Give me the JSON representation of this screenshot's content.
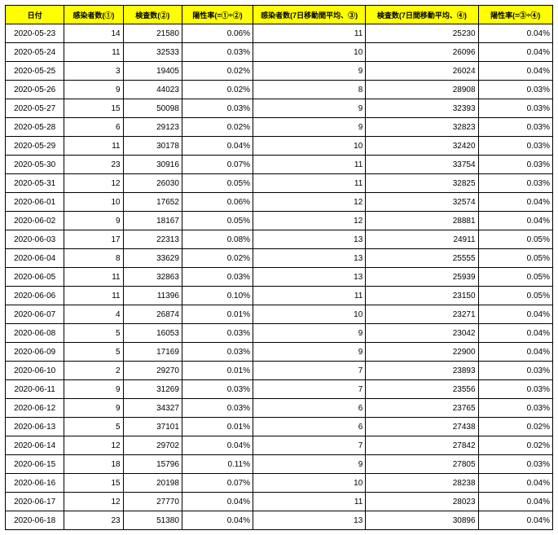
{
  "headers": {
    "date": "日付",
    "infected": "感染者数(①)",
    "tested": "検査数(②)",
    "positivity": "陽性率(=①÷②)",
    "infected7": "感染者数(7日移動間平均、③)",
    "tested7": "検査数(7日間移動平均、④)",
    "positivity7": "陽性率(=③÷④)"
  },
  "rows": [
    {
      "date": "2020-05-23",
      "inf": "14",
      "test": "21580",
      "pos": "0.06%",
      "inf7": "11",
      "test7": "25230",
      "pos7": "0.04%"
    },
    {
      "date": "2020-05-24",
      "inf": "11",
      "test": "32533",
      "pos": "0.03%",
      "inf7": "10",
      "test7": "26096",
      "pos7": "0.04%"
    },
    {
      "date": "2020-05-25",
      "inf": "3",
      "test": "19405",
      "pos": "0.02%",
      "inf7": "9",
      "test7": "26024",
      "pos7": "0.04%"
    },
    {
      "date": "2020-05-26",
      "inf": "9",
      "test": "44023",
      "pos": "0.02%",
      "inf7": "8",
      "test7": "28908",
      "pos7": "0.03%"
    },
    {
      "date": "2020-05-27",
      "inf": "15",
      "test": "50098",
      "pos": "0.03%",
      "inf7": "9",
      "test7": "32393",
      "pos7": "0.03%"
    },
    {
      "date": "2020-05-28",
      "inf": "6",
      "test": "29123",
      "pos": "0.02%",
      "inf7": "9",
      "test7": "32823",
      "pos7": "0.03%"
    },
    {
      "date": "2020-05-29",
      "inf": "11",
      "test": "30178",
      "pos": "0.04%",
      "inf7": "10",
      "test7": "32420",
      "pos7": "0.03%"
    },
    {
      "date": "2020-05-30",
      "inf": "23",
      "test": "30916",
      "pos": "0.07%",
      "inf7": "11",
      "test7": "33754",
      "pos7": "0.03%"
    },
    {
      "date": "2020-05-31",
      "inf": "12",
      "test": "26030",
      "pos": "0.05%",
      "inf7": "11",
      "test7": "32825",
      "pos7": "0.03%"
    },
    {
      "date": "2020-06-01",
      "inf": "10",
      "test": "17652",
      "pos": "0.06%",
      "inf7": "12",
      "test7": "32574",
      "pos7": "0.04%"
    },
    {
      "date": "2020-06-02",
      "inf": "9",
      "test": "18167",
      "pos": "0.05%",
      "inf7": "12",
      "test7": "28881",
      "pos7": "0.04%"
    },
    {
      "date": "2020-06-03",
      "inf": "17",
      "test": "22313",
      "pos": "0.08%",
      "inf7": "13",
      "test7": "24911",
      "pos7": "0.05%"
    },
    {
      "date": "2020-06-04",
      "inf": "8",
      "test": "33629",
      "pos": "0.02%",
      "inf7": "13",
      "test7": "25555",
      "pos7": "0.05%"
    },
    {
      "date": "2020-06-05",
      "inf": "11",
      "test": "32863",
      "pos": "0.03%",
      "inf7": "13",
      "test7": "25939",
      "pos7": "0.05%"
    },
    {
      "date": "2020-06-06",
      "inf": "11",
      "test": "11396",
      "pos": "0.10%",
      "inf7": "11",
      "test7": "23150",
      "pos7": "0.05%"
    },
    {
      "date": "2020-06-07",
      "inf": "4",
      "test": "26874",
      "pos": "0.01%",
      "inf7": "10",
      "test7": "23271",
      "pos7": "0.04%"
    },
    {
      "date": "2020-06-08",
      "inf": "5",
      "test": "16053",
      "pos": "0.03%",
      "inf7": "9",
      "test7": "23042",
      "pos7": "0.04%"
    },
    {
      "date": "2020-06-09",
      "inf": "5",
      "test": "17169",
      "pos": "0.03%",
      "inf7": "9",
      "test7": "22900",
      "pos7": "0.04%"
    },
    {
      "date": "2020-06-10",
      "inf": "2",
      "test": "29270",
      "pos": "0.01%",
      "inf7": "7",
      "test7": "23893",
      "pos7": "0.03%"
    },
    {
      "date": "2020-06-11",
      "inf": "9",
      "test": "31269",
      "pos": "0.03%",
      "inf7": "7",
      "test7": "23556",
      "pos7": "0.03%"
    },
    {
      "date": "2020-06-12",
      "inf": "9",
      "test": "34327",
      "pos": "0.03%",
      "inf7": "6",
      "test7": "23765",
      "pos7": "0.03%"
    },
    {
      "date": "2020-06-13",
      "inf": "5",
      "test": "37101",
      "pos": "0.01%",
      "inf7": "6",
      "test7": "27438",
      "pos7": "0.02%"
    },
    {
      "date": "2020-06-14",
      "inf": "12",
      "test": "29702",
      "pos": "0.04%",
      "inf7": "7",
      "test7": "27842",
      "pos7": "0.02%"
    },
    {
      "date": "2020-06-15",
      "inf": "18",
      "test": "15796",
      "pos": "0.11%",
      "inf7": "9",
      "test7": "27805",
      "pos7": "0.03%"
    },
    {
      "date": "2020-06-16",
      "inf": "15",
      "test": "20198",
      "pos": "0.07%",
      "inf7": "10",
      "test7": "28238",
      "pos7": "0.04%"
    },
    {
      "date": "2020-06-17",
      "inf": "12",
      "test": "27770",
      "pos": "0.04%",
      "inf7": "11",
      "test7": "28023",
      "pos7": "0.04%"
    },
    {
      "date": "2020-06-18",
      "inf": "23",
      "test": "51380",
      "pos": "0.04%",
      "inf7": "13",
      "test7": "30896",
      "pos7": "0.04%"
    }
  ]
}
